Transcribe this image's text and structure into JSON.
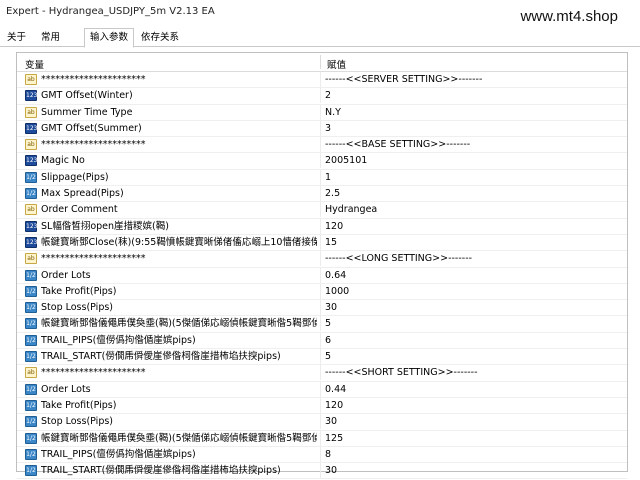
{
  "window": {
    "title": "Expert - Hydrangea_USDJPY_5m V2.13 EA",
    "watermark": "www.mt4.shop"
  },
  "tabs": [
    {
      "label": "关于"
    },
    {
      "label": "常用"
    },
    {
      "label": "输入参数"
    },
    {
      "label": "依存关系"
    }
  ],
  "table": {
    "col_variable": "变量",
    "col_value": "赋值",
    "rows": [
      {
        "type": "ab",
        "name": "**********************",
        "value": "------<<SERVER SETTING>>-------"
      },
      {
        "type": "num",
        "name": "GMT Offset(Winter)",
        "value": "2"
      },
      {
        "type": "ab",
        "name": "Summer Time Type",
        "value": "N.Y"
      },
      {
        "type": "num",
        "name": "GMT Offset(Summer)",
        "value": "3"
      },
      {
        "type": "ab",
        "name": "**********************",
        "value": "------<<BASE SETTING>>-------"
      },
      {
        "type": "num",
        "name": "Magic No",
        "value": "2005101"
      },
      {
        "type": "dbl",
        "name": "Slippage(Pips)",
        "value": "1"
      },
      {
        "type": "dbl",
        "name": "Max Spread(Pips)",
        "value": "2.5"
      },
      {
        "type": "ab",
        "name": "Order Comment",
        "value": "Hydrangea"
      },
      {
        "type": "num",
        "name": "SL幅偺晳挧open崖措糭嫔(鞨)",
        "value": "120"
      },
      {
        "type": "num",
        "name": "帳鍵寶晰鄧Close(秣)(9:55鞨憤帳鍵寶晰俤偖傗応嵶上10懎偖接偨傗?...",
        "value": "15"
      },
      {
        "type": "ab",
        "name": "**********************",
        "value": "------<<LONG SETTING>>-------"
      },
      {
        "type": "dbl",
        "name": "Order Lots",
        "value": "0.64"
      },
      {
        "type": "dbl",
        "name": "Take Profit(Pips)",
        "value": "1000"
      },
      {
        "type": "dbl",
        "name": "Stop Loss(Pips)",
        "value": "30"
      },
      {
        "type": "dbl",
        "name": "帳鍵寶晰鄧偺儀僶乕僕奐埀(鞨)(5傑偱俤応嵶偵帳鍵寶晰偺5鞨鄧偵偍?...",
        "value": "5"
      },
      {
        "type": "dbl",
        "name": "TRAIL_PIPS(儃僗僞拘偺偱崖嫔pips)",
        "value": "6"
      },
      {
        "type": "dbl",
        "name": "TRAIL_START(僗僩乕僢僾崖傪偺柌偺崖措柨埳扶揬pips)",
        "value": "5"
      },
      {
        "type": "ab",
        "name": "**********************",
        "value": "------<<SHORT SETTING>>-------"
      },
      {
        "type": "dbl",
        "name": "Order Lots",
        "value": "0.44"
      },
      {
        "type": "dbl",
        "name": "Take Profit(Pips)",
        "value": "120"
      },
      {
        "type": "dbl",
        "name": "Stop Loss(Pips)",
        "value": "30"
      },
      {
        "type": "dbl",
        "name": "帳鍵寶晰鄧偺儀僶乕僕奐埀(鞨)(5傑偱俤応嵶偵帳鍵寶晰偺5鞨鄧偵偍?...",
        "value": "125"
      },
      {
        "type": "dbl",
        "name": "TRAIL_PIPS(儃僗僞拘偺偱崖嫔pips)",
        "value": "8"
      },
      {
        "type": "dbl",
        "name": "TRAIL_START(僗僩乕僢僾崖傪偺柌偺崖措柨埳扶揬pips)",
        "value": "30"
      }
    ]
  },
  "icons": {
    "ab": "string-param-icon",
    "num": "integer-param-icon",
    "dbl": "double-param-icon"
  }
}
